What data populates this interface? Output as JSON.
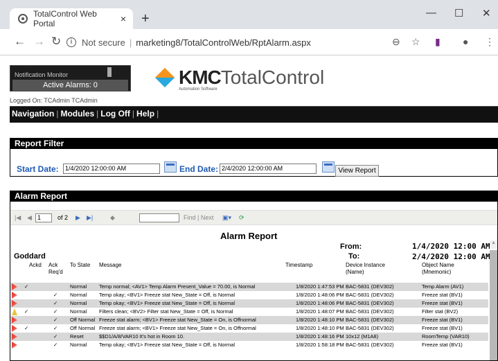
{
  "browser": {
    "tab_title": "TotalControl Web Portal",
    "tab_close": "×",
    "new_tab": "+",
    "minimize": "—",
    "maximize": "☐",
    "close": "✕",
    "not_secure": "Not secure",
    "url": "marketing8/TotalControlWeb/RptAlarm.aspx"
  },
  "header": {
    "notification_label": "Notification Monitor",
    "active_alarms": "Active Alarms: 0",
    "logo_kmc": "KMC",
    "logo_tc": "TotalControl",
    "logo_sub": "Automation Software",
    "logged_on": "Logged On: TCAdmin TCAdmin"
  },
  "menu": [
    "Navigation",
    "Modules",
    "Log Off",
    "Help"
  ],
  "filter": {
    "heading": "Report Filter",
    "start_label": "Start Date:",
    "start_value": "1/4/2020 12:00:00 AM",
    "end_label": "End Date:",
    "end_value": "2/4/2020 12:00:00 AM",
    "view_button": "View Report"
  },
  "report": {
    "heading": "Alarm Report",
    "page_value": "1",
    "page_of": "of 2",
    "find_label": "Find | Next",
    "title": "Alarm Report",
    "site": "Goddard",
    "from_label": "From:",
    "from_value": "1/4/2020 12:00 AM",
    "to_label": "To:",
    "to_value": "2/4/2020 12:00 AM",
    "columns": {
      "ackd": "Ackd",
      "ack_reqd": "Ack Req'd",
      "to_state": "To State",
      "message": "Message",
      "timestamp": "Timestamp",
      "device": "Device Instance (Name)",
      "object": "Object Name (Mnemonic)"
    },
    "rows": [
      {
        "ackd": "✓",
        "req": "",
        "state": "Normal",
        "msg": "Temp normal; <AV1> Temp Alarm Present_Value = 70.00, is Normal",
        "ts": "1/8/2020 1:47:53 PM",
        "dev": "BAC-5831 (DEV302)",
        "obj": "Temp Alarm (AV1)"
      },
      {
        "ackd": "",
        "req": "✓",
        "state": "Normal",
        "msg": "Temp okay; <BV1> Freeze stat New_State = Off, is Normal",
        "ts": "1/8/2020 1:48:06 PM",
        "dev": "BAC-5831 (DEV302)",
        "obj": "Freeze stat (BV1)"
      },
      {
        "ackd": "",
        "req": "✓",
        "state": "Normal",
        "msg": "Temp okay; <BV1> Freeze stat New_State = Off, is Normal",
        "ts": "1/8/2020 1:48:06 PM",
        "dev": "BAC-5831 (DEV302)",
        "obj": "Freeze stat (BV1)"
      },
      {
        "ackd": "✓",
        "req": "✓",
        "state": "Normal",
        "msg": "Filters clean; <BV2> Filter stat New_State = Off, is Normal",
        "ts": "1/8/2020 1:48:07 PM",
        "dev": "BAC-5831 (DEV302)",
        "obj": "Filter stat (BV2)"
      },
      {
        "ackd": "",
        "req": "✓",
        "state": "Off Normal",
        "msg": "Freeze stat alarm; <BV1> Freeze stat New_State = On, is Offnormal",
        "ts": "1/8/2020 1:48:10 PM",
        "dev": "BAC-5831 (DEV302)",
        "obj": "Freeze stat (BV1)"
      },
      {
        "ackd": "✓",
        "req": "✓",
        "state": "Off Normal",
        "msg": "Freeze stat alarm; <BV1> Freeze stat New_State = On, is Offnormal",
        "ts": "1/8/2020 1:48:10 PM",
        "dev": "BAC-5831 (DEV302)",
        "obj": "Freeze stat (BV1)"
      },
      {
        "ackd": "",
        "req": "✓",
        "state": "Reset",
        "msg": "$$D1/A/8/VAR10 It's hot in Room 10.",
        "ts": "1/8/2020 1:48:16 PM",
        "dev": "10x12 (M1A8)",
        "obj": "RoomTemp (VAR10)"
      },
      {
        "ackd": "",
        "req": "✓",
        "state": "Normal",
        "msg": "Temp okay; <BV1> Freeze stat New_State = Off, is Normal",
        "ts": "1/8/2020 1:58:18 PM",
        "dev": "BAC-5831 (DEV302)",
        "obj": "Freeze stat (BV1)"
      }
    ]
  }
}
